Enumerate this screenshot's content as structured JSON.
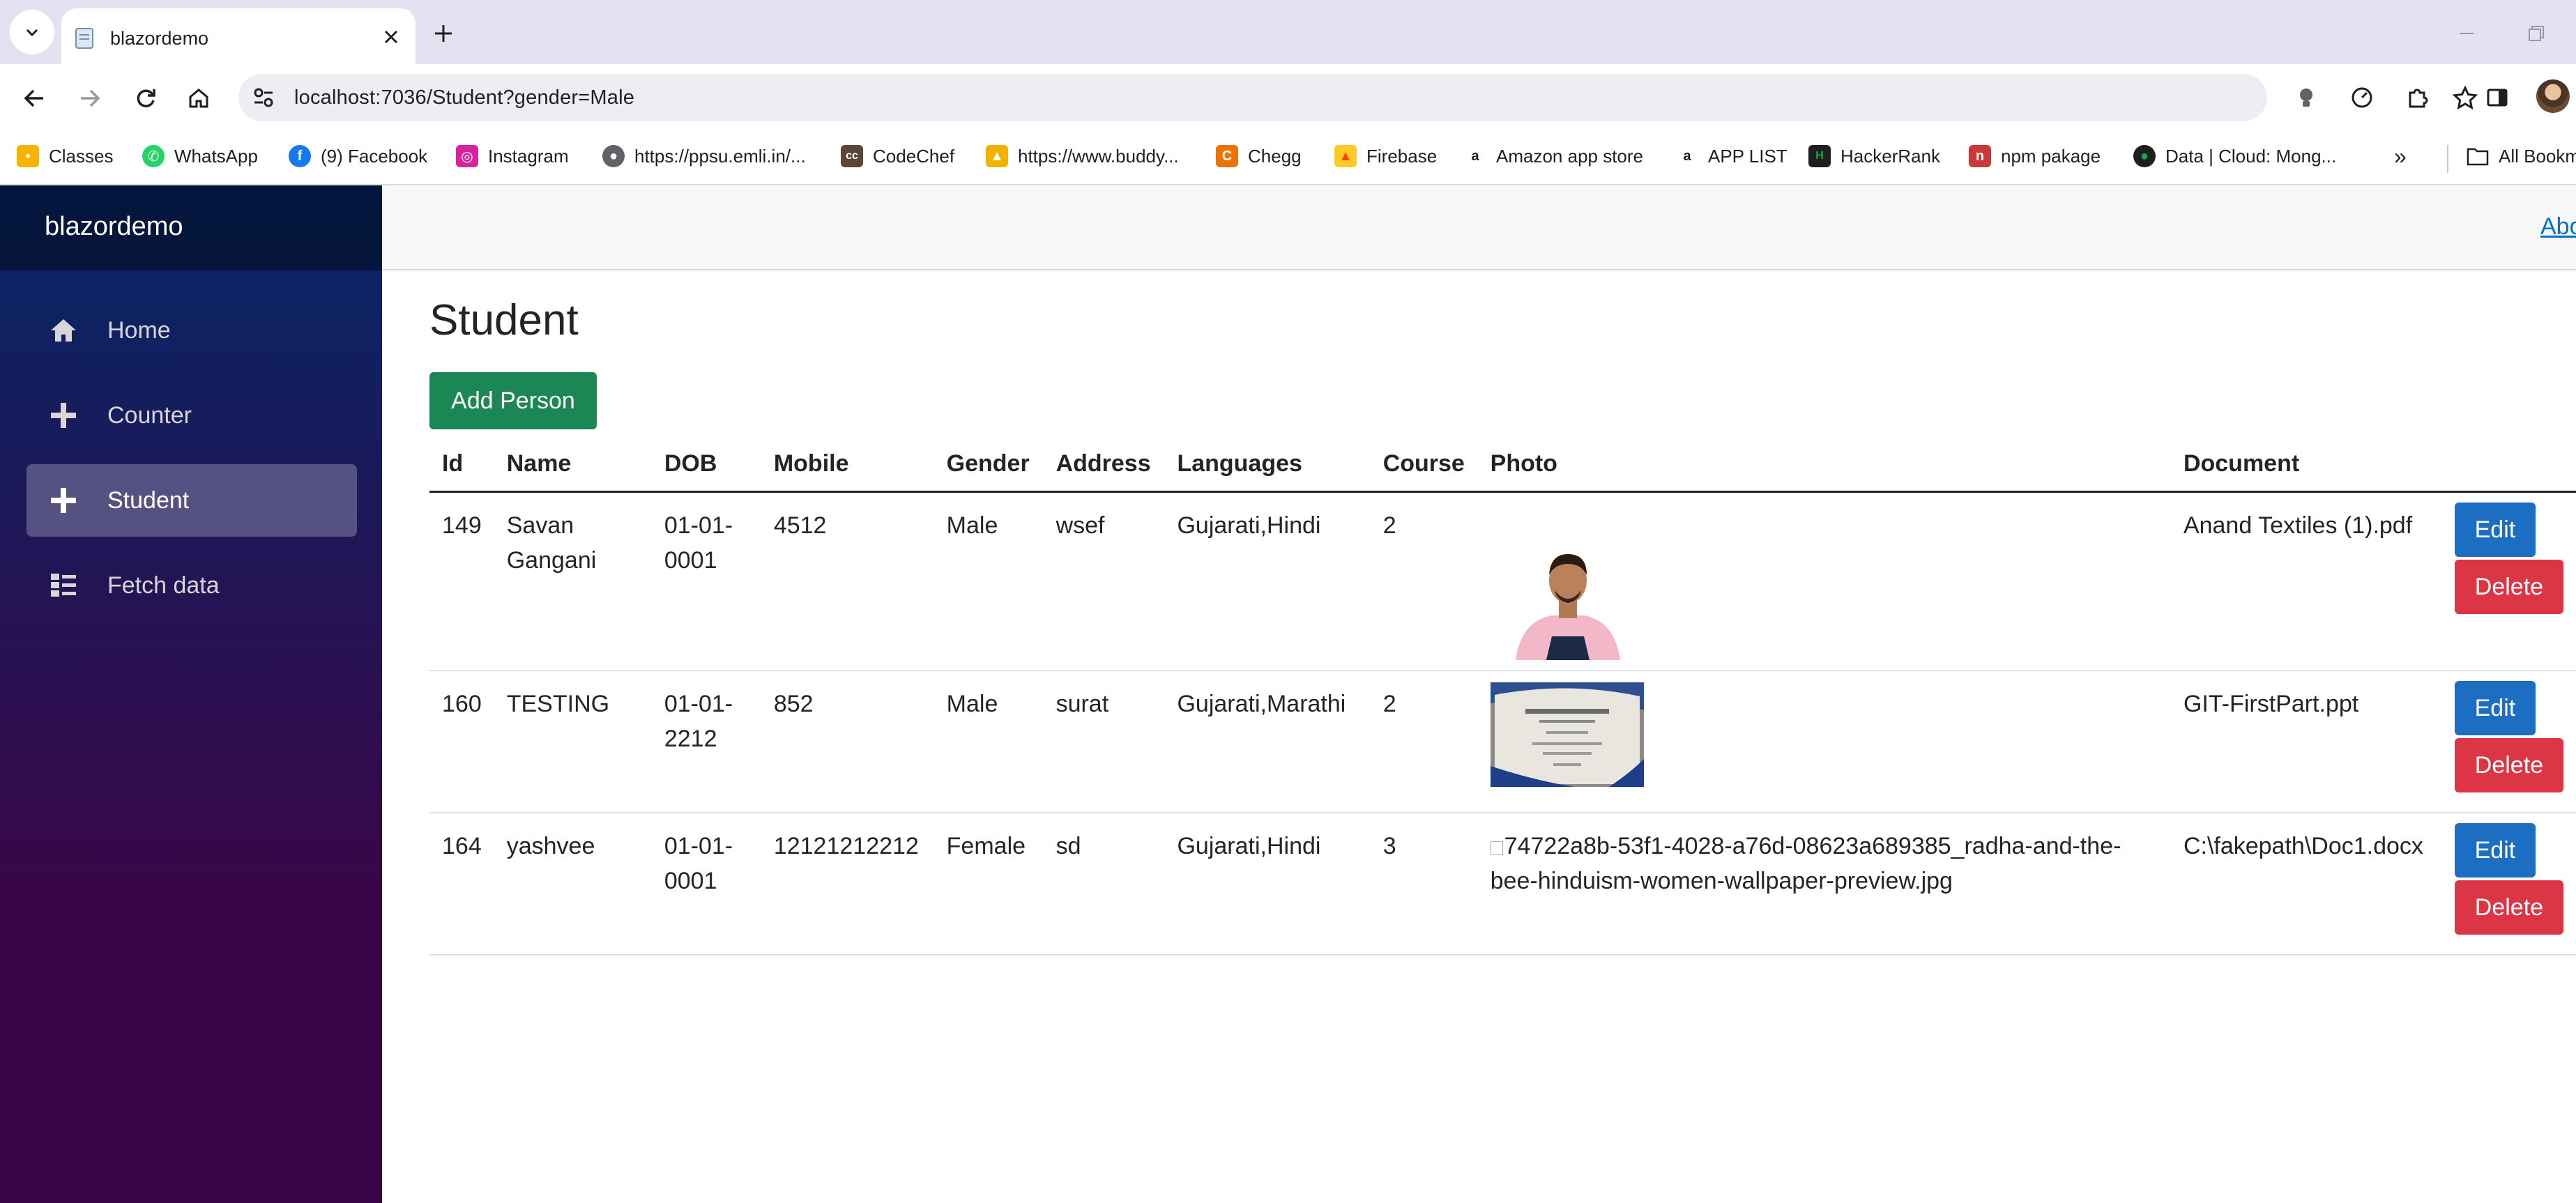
{
  "browser": {
    "tab_title": "blazordemo",
    "url": "localhost:7036/Student?gender=Male",
    "bookmarks": [
      {
        "label": "Classes",
        "icon": "google-classroom-icon",
        "color": "#f6b400"
      },
      {
        "label": "WhatsApp",
        "icon": "whatsapp-icon",
        "color": "#25d366"
      },
      {
        "label": "(9) Facebook",
        "icon": "facebook-icon",
        "color": "#1877f2"
      },
      {
        "label": "Instagram",
        "icon": "instagram-icon",
        "color": "#d6249f"
      },
      {
        "label": "https://ppsu.emli.in/...",
        "icon": "globe-icon",
        "color": "#5f6368"
      },
      {
        "label": "CodeChef",
        "icon": "codechef-icon",
        "color": "#5b4638"
      },
      {
        "label": "https://www.buddy...",
        "icon": "graduation-cap-icon",
        "color": "#f0b400"
      },
      {
        "label": "Chegg",
        "icon": "chegg-icon",
        "color": "#eb7100"
      },
      {
        "label": "Firebase",
        "icon": "firebase-icon",
        "color": "#ffca28"
      },
      {
        "label": "Amazon app store",
        "icon": "amazon-icon",
        "color": "#ff9900"
      },
      {
        "label": "APP LIST",
        "icon": "amazon-icon",
        "color": "#ff9900"
      },
      {
        "label": "HackerRank",
        "icon": "hackerrank-icon",
        "color": "#1ba94c"
      },
      {
        "label": "npm pakage",
        "icon": "npm-icon",
        "color": "#cb3837"
      },
      {
        "label": "Data | Cloud: Mong...",
        "icon": "mongodb-icon",
        "color": "#13aa52"
      },
      {
        "label": "All Bookmarks",
        "icon": "folder-icon",
        "color": "#5f6368"
      }
    ],
    "more_bookmarks": "»"
  },
  "app": {
    "brand": "blazordemo",
    "about_link": "About",
    "nav": [
      {
        "label": "Home",
        "icon": "home-icon",
        "active": false
      },
      {
        "label": "Counter",
        "icon": "plus-icon",
        "active": false
      },
      {
        "label": "Student",
        "icon": "plus-icon",
        "active": true
      },
      {
        "label": "Fetch data",
        "icon": "list-icon",
        "active": false
      }
    ]
  },
  "page": {
    "title": "Student",
    "add_button": "Add Person",
    "edit_label": "Edit",
    "delete_label": "Delete",
    "columns": [
      "Id",
      "Name",
      "DOB",
      "Mobile",
      "Gender",
      "Address",
      "Languages",
      "Course",
      "Photo",
      "Document"
    ],
    "rows": [
      {
        "id": "149",
        "name": "Savan Gangani",
        "dob": "01-01-0001",
        "mobile": "4512",
        "gender": "Male",
        "address": "wsef",
        "languages": "Gujarati,Hindi",
        "course": "2",
        "photo": "person-photo",
        "document": "Anand Textiles (1).pdf"
      },
      {
        "id": "160",
        "name": "TESTING",
        "dob": "01-01-2212",
        "mobile": "852",
        "gender": "Male",
        "address": "surat",
        "languages": "Gujarati,Marathi",
        "course": "2",
        "photo": "certificate-photo",
        "document": "GIT-FirstPart.ppt"
      },
      {
        "id": "164",
        "name": "yashvee",
        "dob": "01-01-0001",
        "mobile": "12121212212",
        "gender": "Female",
        "address": "sd",
        "languages": "Gujarati,Hindi",
        "course": "3",
        "photo_alt": "74722a8b-53f1-4028-a76d-08623a689385_radha-and-the-bee-hinduism-women-wallpaper-preview.jpg",
        "document": "C:\\fakepath\\Doc1.docx"
      }
    ]
  }
}
